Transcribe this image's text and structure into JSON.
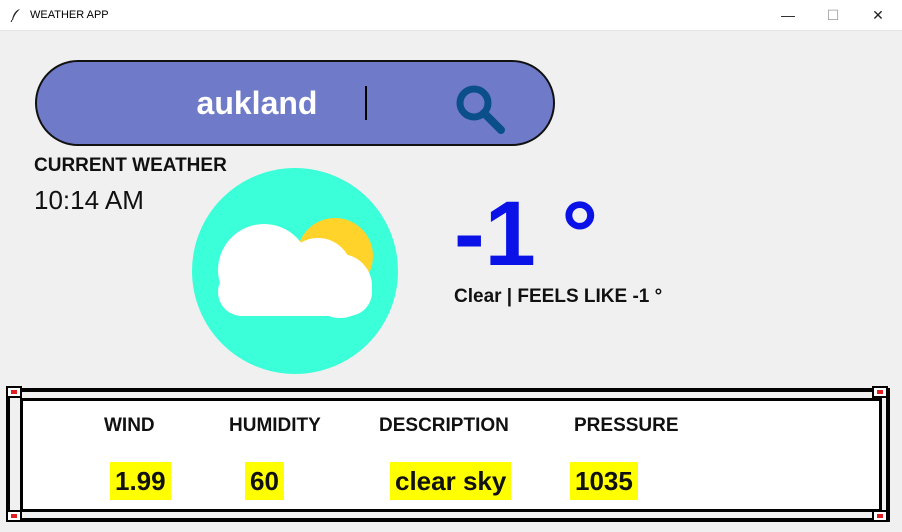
{
  "window": {
    "title": "WEATHER APP",
    "minimize_glyph": "—",
    "maximize_glyph": "☐",
    "close_glyph": "✕"
  },
  "search": {
    "value": "aukland",
    "icon": "search-icon"
  },
  "current": {
    "label": "CURRENT WEATHER",
    "time": "10:14 AM",
    "icon": "partly-cloudy-icon"
  },
  "temperature": {
    "value": "-1 °",
    "summary": "Clear | FEELS LIKE -1 °"
  },
  "stats": {
    "wind": {
      "label": "WIND",
      "value": "1.99"
    },
    "humidity": {
      "label": "HUMIDITY",
      "value": "60"
    },
    "description": {
      "label": "DESCRIPTION",
      "value": "clear sky"
    },
    "pressure": {
      "label": "PRESSURE",
      "value": "1035"
    }
  },
  "colors": {
    "search_bg": "#6f7bc9",
    "circle_bg": "#3affd8",
    "temp_text": "#0a12e8",
    "value_highlight": "#ffff00",
    "sun": "#ffd32a"
  }
}
